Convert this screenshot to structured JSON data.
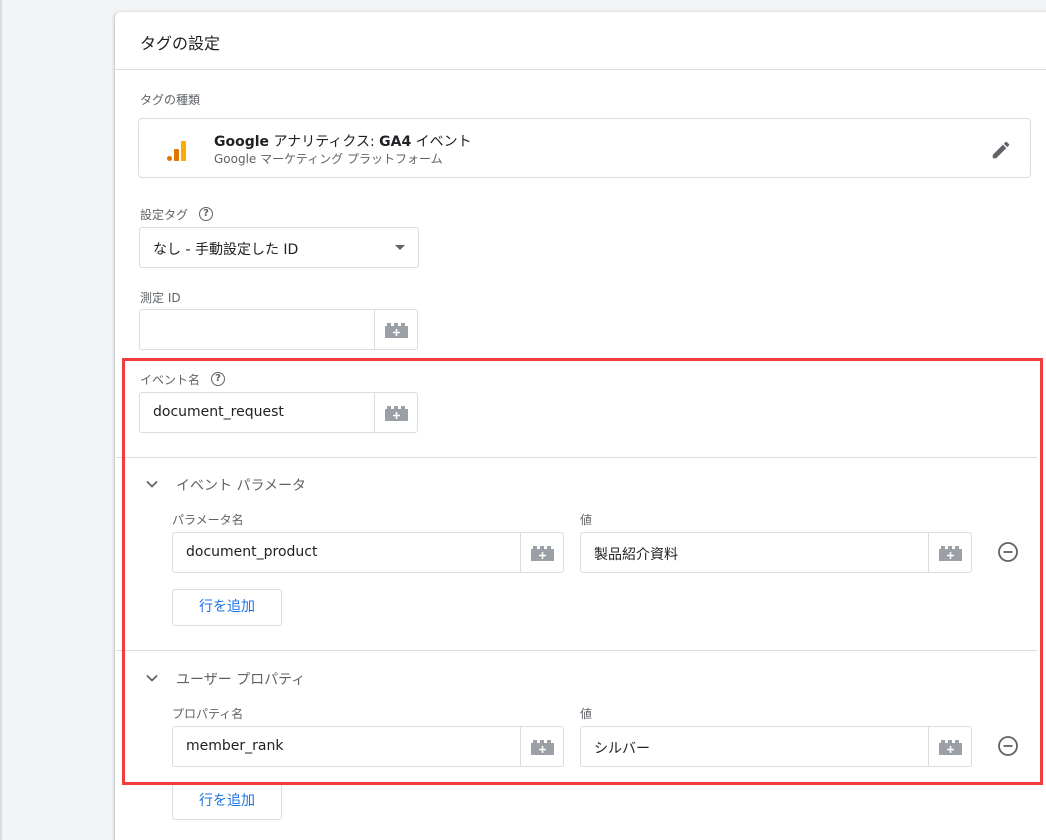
{
  "panel": {
    "title": "タグの設定"
  },
  "tag_type": {
    "label": "タグの種類",
    "name_bold": "Google",
    "name_rest": " アナリティクス: ",
    "name_bold2": "GA4",
    "name_tail": " イベント",
    "platform": "Google マーケティング プラットフォーム",
    "logo_icon": "google-analytics-logo",
    "edit_icon": "pencil-icon"
  },
  "config_tag": {
    "label": "設定タグ",
    "help_icon": "question-circle-icon",
    "selected": "なし - 手動設定した ID"
  },
  "measurement_id": {
    "label": "測定 ID",
    "value": ""
  },
  "event_name": {
    "label": "イベント名",
    "help_icon": "question-circle-icon",
    "value": "document_request"
  },
  "event_params": {
    "section_title": "イベント パラメータ",
    "name_header": "パラメータ名",
    "value_header": "値",
    "rows": [
      {
        "name": "document_product",
        "value": "製品紹介資料"
      }
    ],
    "add_row_label": "行を追加"
  },
  "user_props": {
    "section_title": "ユーザー プロパティ",
    "name_header": "プロパティ名",
    "value_header": "値",
    "rows": [
      {
        "name": "member_rank",
        "value": "シルバー"
      }
    ],
    "add_row_label": "行を追加"
  },
  "colors": {
    "accent": "#1a73e8",
    "highlight": "#f03e3e",
    "ga_orange": "#f9ab00",
    "ga_dark_orange": "#e37400"
  }
}
